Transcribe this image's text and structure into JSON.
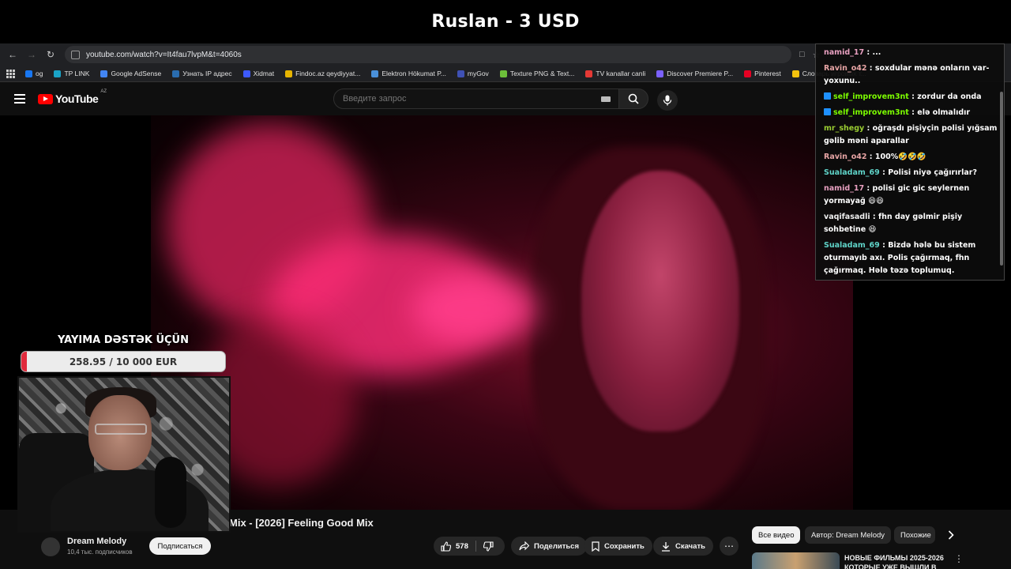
{
  "stream": {
    "banner_title": "Ruslan - 3 USD"
  },
  "browser": {
    "url": "youtube.com/watch?v=It4fau7lvpM&t=4060s",
    "bookmarks": [
      "og",
      "TP LINK",
      "Google AdSense",
      "Узнать IP адрес",
      "Xidmat",
      "Findoc.az qeydiyyat...",
      "Elektron Hökumat P...",
      "myGov",
      "Texture PNG & Text...",
      "TV kanallar canli",
      "Discover Premiere P...",
      "Pinterest",
      "Словарь игровых т..."
    ],
    "bookmark_colors": [
      "#1877f2",
      "#1aa3c7",
      "#4285f4",
      "#2a6db0",
      "#3d5afe",
      "#e6b400",
      "#4a90d9",
      "#3f51b5",
      "#6dbf3a",
      "#e53935",
      "#7b61ff",
      "#e60023",
      "#f4c20d"
    ]
  },
  "youtube": {
    "logo_text": "YouTube",
    "region": "AZ",
    "search_placeholder": "Введите запрос",
    "video_title": "Mix - [2026] Feeling Good Mix",
    "channel_name": "Dream Melody",
    "channel_subs": "10,4 тыс. подписчиков",
    "subscribe_label": "Подписаться",
    "likes": "578",
    "share_label": "Поделиться",
    "save_label": "Сохранить",
    "download_label": "Скачать",
    "chips": [
      "Все видео",
      "Автор: Dream Melody",
      "Похожие"
    ],
    "rec_title": "НОВЫЕ ФИЛЬМЫ 2025-2026 КОТОРЫЕ УЖЕ ВЫШЛИ В"
  },
  "donation": {
    "title": "YAYIMA DƏSTƏK ÜÇÜN",
    "progress_text": "258.95 / 10 000 EUR",
    "progress_fraction": 0.0259,
    "fill_color": "#e02a3c"
  },
  "chat": {
    "messages": [
      {
        "user": "namid_17",
        "color": "#e8a0c0",
        "text": "...",
        "badge": false
      },
      {
        "user": "Ravin_o42",
        "color": "#e6a4a4",
        "text": "soxdular mənə onların var-yoxunu..",
        "badge": false
      },
      {
        "user": "self_improvem3nt",
        "color": "#7cfc00",
        "text": "zordur da onda",
        "badge": true
      },
      {
        "user": "self_improvem3nt",
        "color": "#7cfc00",
        "text": "elə olmalıdır",
        "badge": true
      },
      {
        "user": "mr_shegy",
        "color": "#9acd32",
        "text": "oğraşdı pişiyçin polisi yığsam gəlib məni aparallar",
        "badge": false
      },
      {
        "user": "Ravin_o42",
        "color": "#e6a4a4",
        "text": "100%🤣🤣🤣",
        "badge": false
      },
      {
        "user": "Sualadam_69",
        "color": "#5fd3c8",
        "text": "Polisi niyə çağırırlar?",
        "badge": false
      },
      {
        "user": "namid_17",
        "color": "#e8a0c0",
        "text": "polisi gic gic seylernen yormayağ 😆😆",
        "badge": false
      },
      {
        "user": "vaqifasadli",
        "color": "#f0f0f0",
        "text": "fhn day gəlmir pişiy sohbetine 😆",
        "badge": false
      },
      {
        "user": "Sualadam_69",
        "color": "#5fd3c8",
        "text": "Bizdə hələ bu sistem oturmayıb axı. Polis çağırmaq, fhn çağırmaq. Hələ təzə toplumuq.",
        "badge": false
      }
    ]
  }
}
